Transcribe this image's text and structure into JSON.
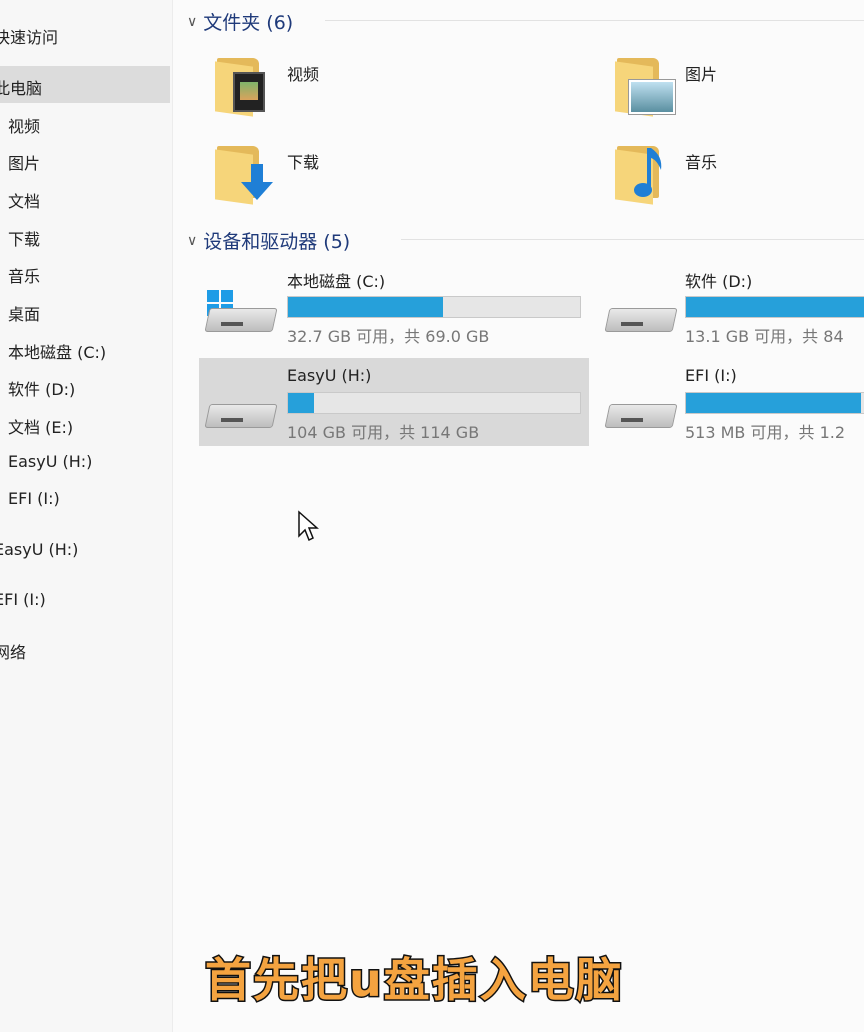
{
  "sidebar": {
    "items": [
      {
        "label": "快速访问"
      },
      {
        "label": "此电脑"
      },
      {
        "label": "视频"
      },
      {
        "label": "图片"
      },
      {
        "label": "文档"
      },
      {
        "label": "下载"
      },
      {
        "label": "音乐"
      },
      {
        "label": "桌面"
      },
      {
        "label": "本地磁盘 (C:)"
      },
      {
        "label": "软件 (D:)"
      },
      {
        "label": "文档 (E:)"
      },
      {
        "label": "EasyU (H:)"
      },
      {
        "label": "EFI (I:)"
      },
      {
        "label": "EasyU (H:)"
      },
      {
        "label": "EFI (I:)"
      },
      {
        "label": "网络"
      }
    ]
  },
  "folders_group": {
    "title": "文件夹 (6)",
    "items": [
      {
        "label": "视频",
        "icon": "video-folder-icon"
      },
      {
        "label": "图片",
        "icon": "pictures-folder-icon"
      },
      {
        "label": "下载",
        "icon": "downloads-folder-icon"
      },
      {
        "label": "音乐",
        "icon": "music-folder-icon"
      }
    ]
  },
  "drives_group": {
    "title": "设备和驱动器 (5)",
    "items": [
      {
        "name": "本地磁盘 (C:)",
        "info": "32.7 GB 可用，共 69.0 GB",
        "used_fraction": 0.53
      },
      {
        "name": "软件 (D:)",
        "info": "13.1 GB 可用，共 84",
        "used_fraction": 0.85
      },
      {
        "name": "EasyU (H:)",
        "info": "104 GB 可用，共 114 GB",
        "used_fraction": 0.09
      },
      {
        "name": "EFI (I:)",
        "info": "513 MB 可用，共 1.2",
        "used_fraction": 0.6
      }
    ]
  },
  "caption": {
    "text": "首先把u盘插入电脑"
  },
  "colors": {
    "accent": "#26a0da",
    "caption": "#f4a340",
    "header": "#1f3a7a"
  }
}
